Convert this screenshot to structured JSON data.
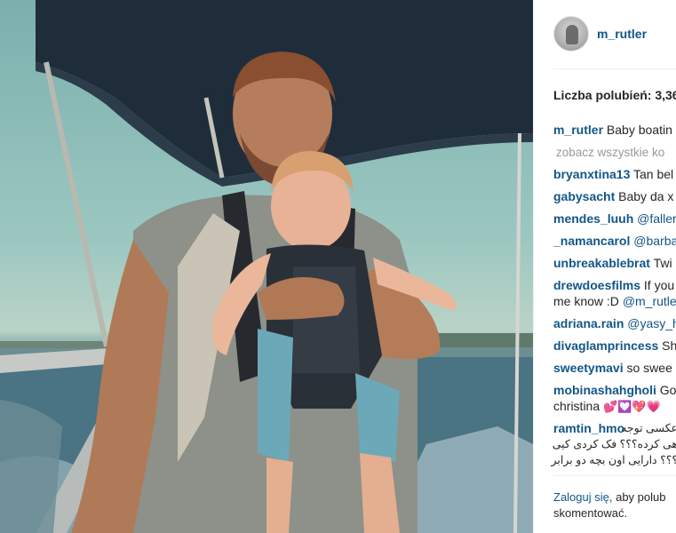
{
  "post": {
    "username": "m_rutler",
    "likes_text": "Liczba polubień: 3,36",
    "caption": {
      "user": "m_rutler",
      "text": "Baby boatin"
    },
    "see_all": "zobacz wszystkie ko",
    "comments": [
      {
        "user": "bryanxtina13",
        "text": "Tan bel"
      },
      {
        "user": "gabysacht",
        "text": "Baby da x"
      },
      {
        "user": "mendes_luuh",
        "text": "@faller",
        "mention": true
      },
      {
        "user": "_namancarol",
        "text": "@barba",
        "mention": true
      },
      {
        "user": "unbreakablebrat",
        "text": "Twi"
      },
      {
        "user": "drewdoesfilms",
        "text": "If you",
        "line2": "me know :D ",
        "line2_mention": "@m_rutle"
      },
      {
        "user": "adriana.rain",
        "text": "@yasy_h",
        "mention": true
      },
      {
        "user": "divaglamprincess",
        "text": "Sh"
      },
      {
        "user": "sweetymavi",
        "text": "so swee"
      },
      {
        "user": "mobinashahgholi",
        "text": "Go",
        "line2": "christina",
        "emoji": "💕💟💖💗"
      },
      {
        "user": "ramtin_hmo",
        "rtl_lines": [
          "عکسی توجه",
          "هی کرده؟؟؟ فک کردی کیی",
          "؟؟؟ دارایی اون بچه دو برابر"
        ]
      }
    ],
    "footer": {
      "login": "Zaloguj się,",
      "rest": " aby polub",
      "line2": "skomentować."
    }
  },
  "colors": {
    "link": "#125688",
    "text": "#262626",
    "muted": "#999999",
    "sky": "#8cbdb8",
    "canopy": "#1f2d3a"
  }
}
